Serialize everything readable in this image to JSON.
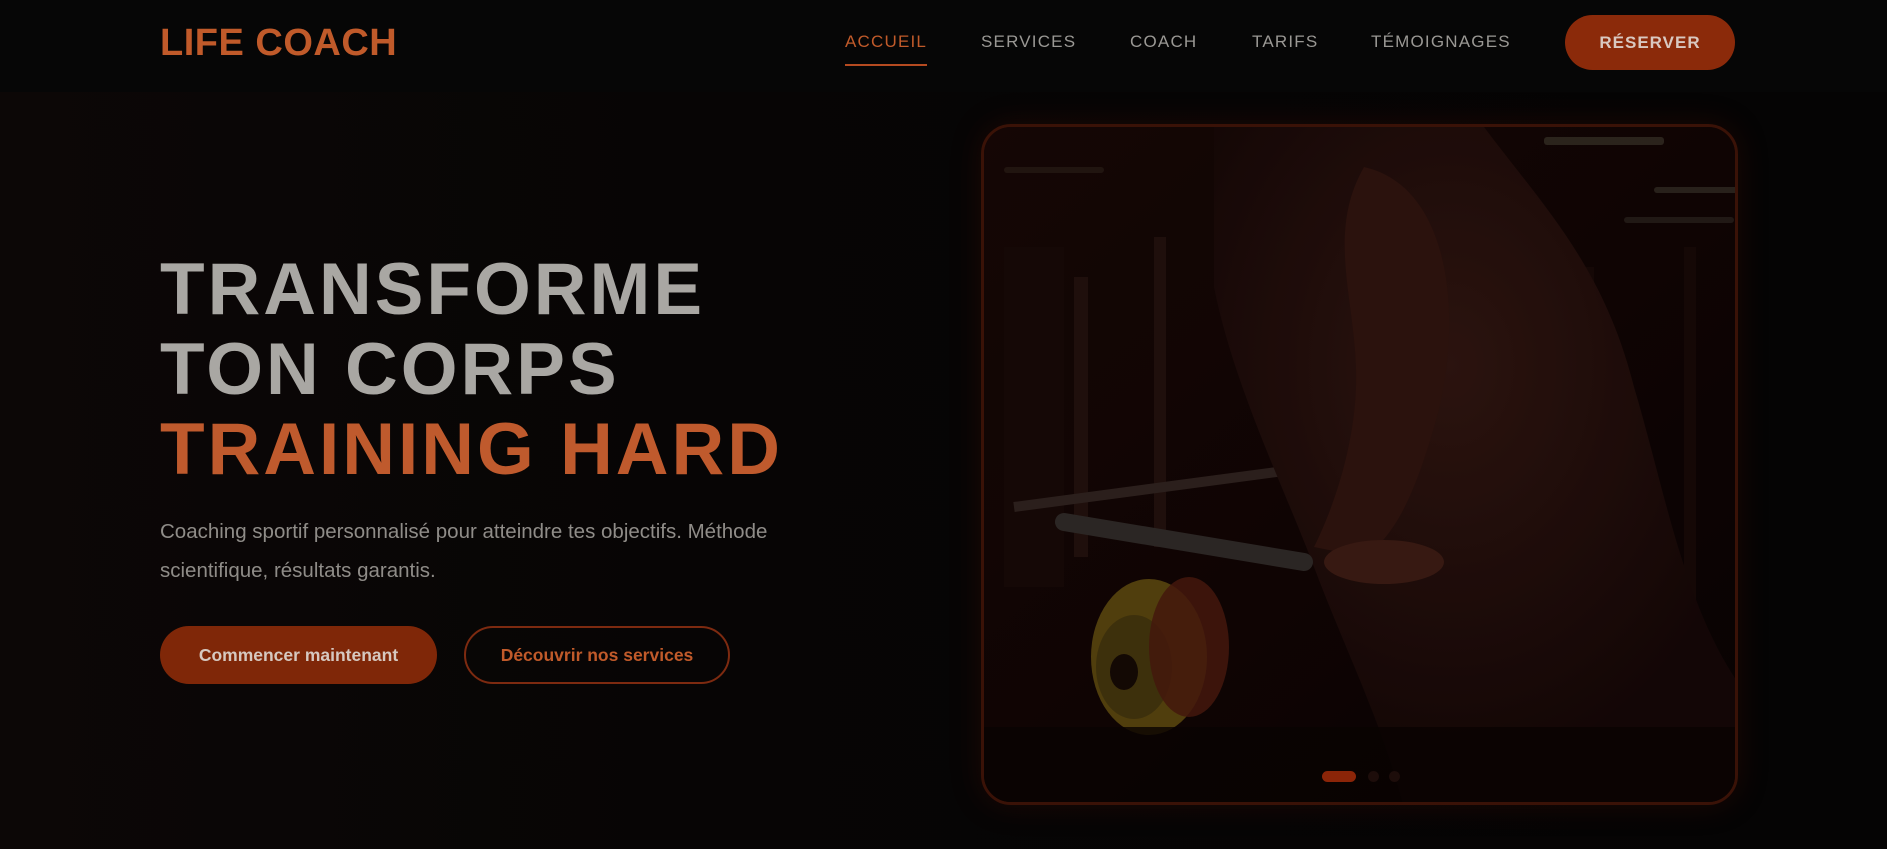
{
  "header": {
    "logo": "LIFE COACH",
    "nav": [
      {
        "label": "ACCUEIL",
        "active": true
      },
      {
        "label": "SERVICES",
        "active": false
      },
      {
        "label": "COACH",
        "active": false
      },
      {
        "label": "TARIFS",
        "active": false
      },
      {
        "label": "TÉMOIGNAGES",
        "active": false
      }
    ],
    "reserve_label": "RÉSERVER"
  },
  "hero": {
    "title_line1": "TRANSFORME",
    "title_line2": "TON CORPS",
    "title_line3": "TRAINING HARD",
    "description": "Coaching sportif personnalisé pour atteindre tes objectifs. Méthode scientifique, résultats garantis.",
    "primary_cta": "Commencer maintenant",
    "secondary_cta": "Découvrir nos services"
  },
  "slider": {
    "slide_count": 3,
    "active_index": 0
  },
  "colors": {
    "accent": "#c05a2a",
    "button_fill": "#7f2708",
    "background": "#050404",
    "text_light": "#a9a7a3"
  }
}
